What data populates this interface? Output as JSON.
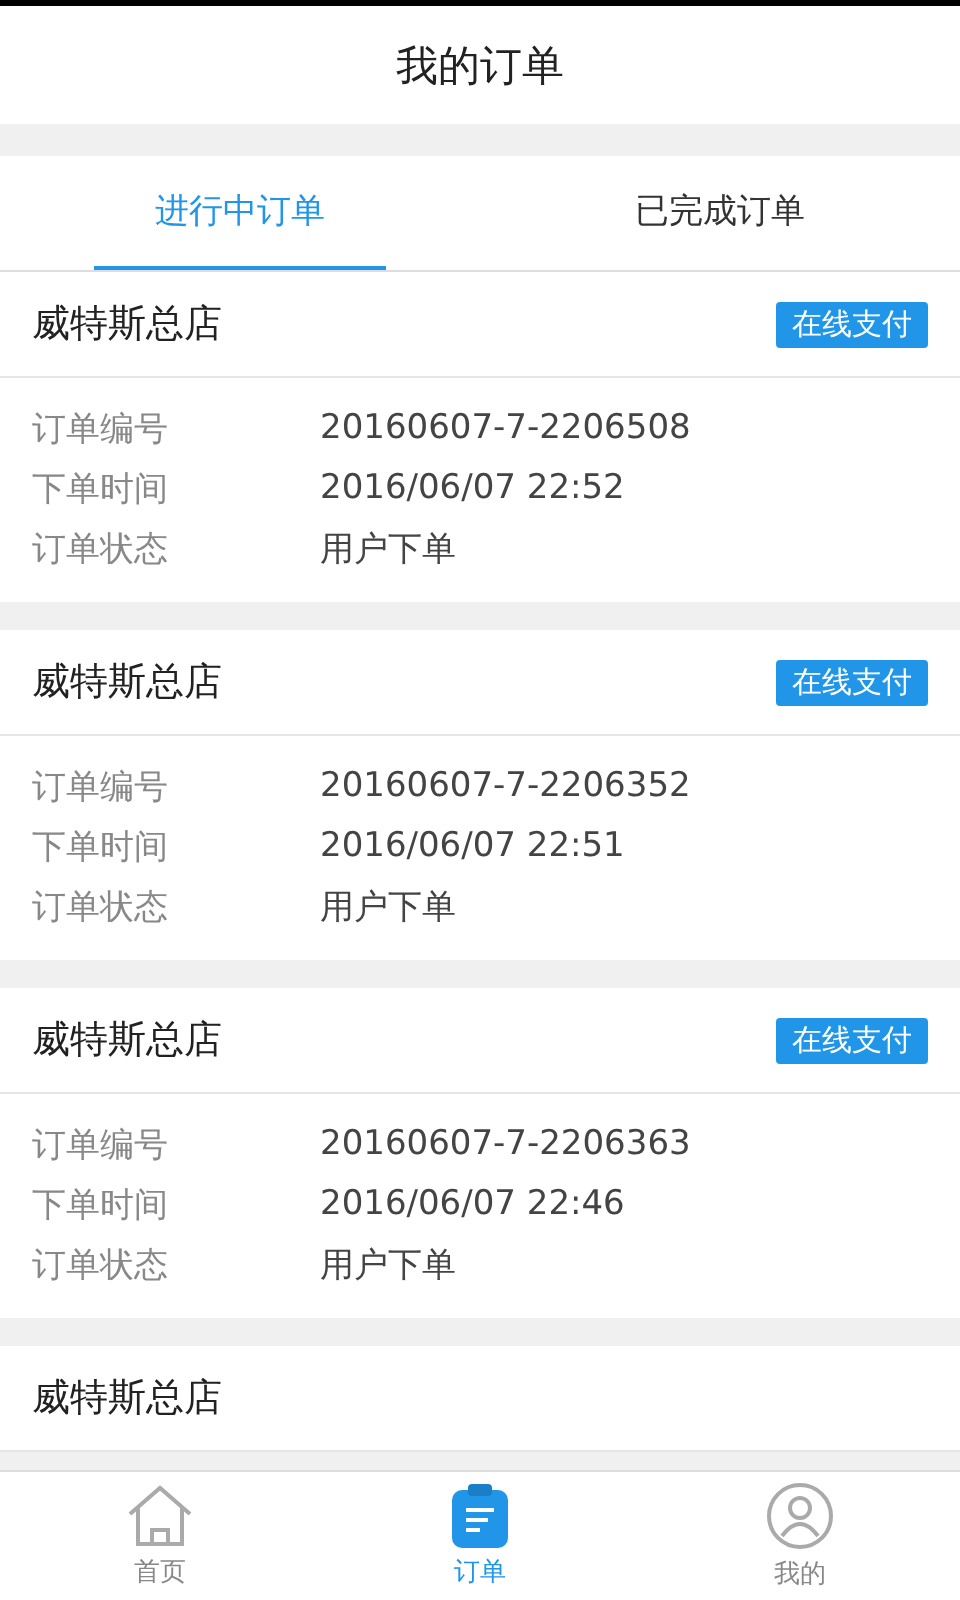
{
  "title": "我的订单",
  "tabs": [
    {
      "label": "进行中订单",
      "selected": true
    },
    {
      "label": "已完成订单",
      "selected": false
    }
  ],
  "orders": [
    {
      "store": "威特斯总店",
      "payment": "在线支付",
      "fields": [
        {
          "label": "订单编号",
          "value": "20160607-7-2206508"
        },
        {
          "label": "下单时间",
          "value": "2016/06/07 22:52"
        },
        {
          "label": "订单状态",
          "value": "用户下单"
        }
      ]
    },
    {
      "store": "威特斯总店",
      "payment": "在线支付",
      "fields": [
        {
          "label": "订单编号",
          "value": "20160607-7-2206352"
        },
        {
          "label": "下单时间",
          "value": "2016/06/07 22:51"
        },
        {
          "label": "订单状态",
          "value": "用户下单"
        }
      ]
    },
    {
      "store": "威特斯总店",
      "payment": "在线支付",
      "fields": [
        {
          "label": "订单编号",
          "value": "20160607-7-2206363"
        },
        {
          "label": "下单时间",
          "value": "2016/06/07 22:46"
        },
        {
          "label": "订单状态",
          "value": "用户下单"
        }
      ]
    },
    {
      "store": "威特斯总店"
    }
  ],
  "nav": [
    {
      "kind": "home",
      "label": "首页",
      "selected": false
    },
    {
      "kind": "orders",
      "label": "订单",
      "selected": true
    },
    {
      "kind": "profile",
      "label": "我的",
      "selected": false
    }
  ]
}
